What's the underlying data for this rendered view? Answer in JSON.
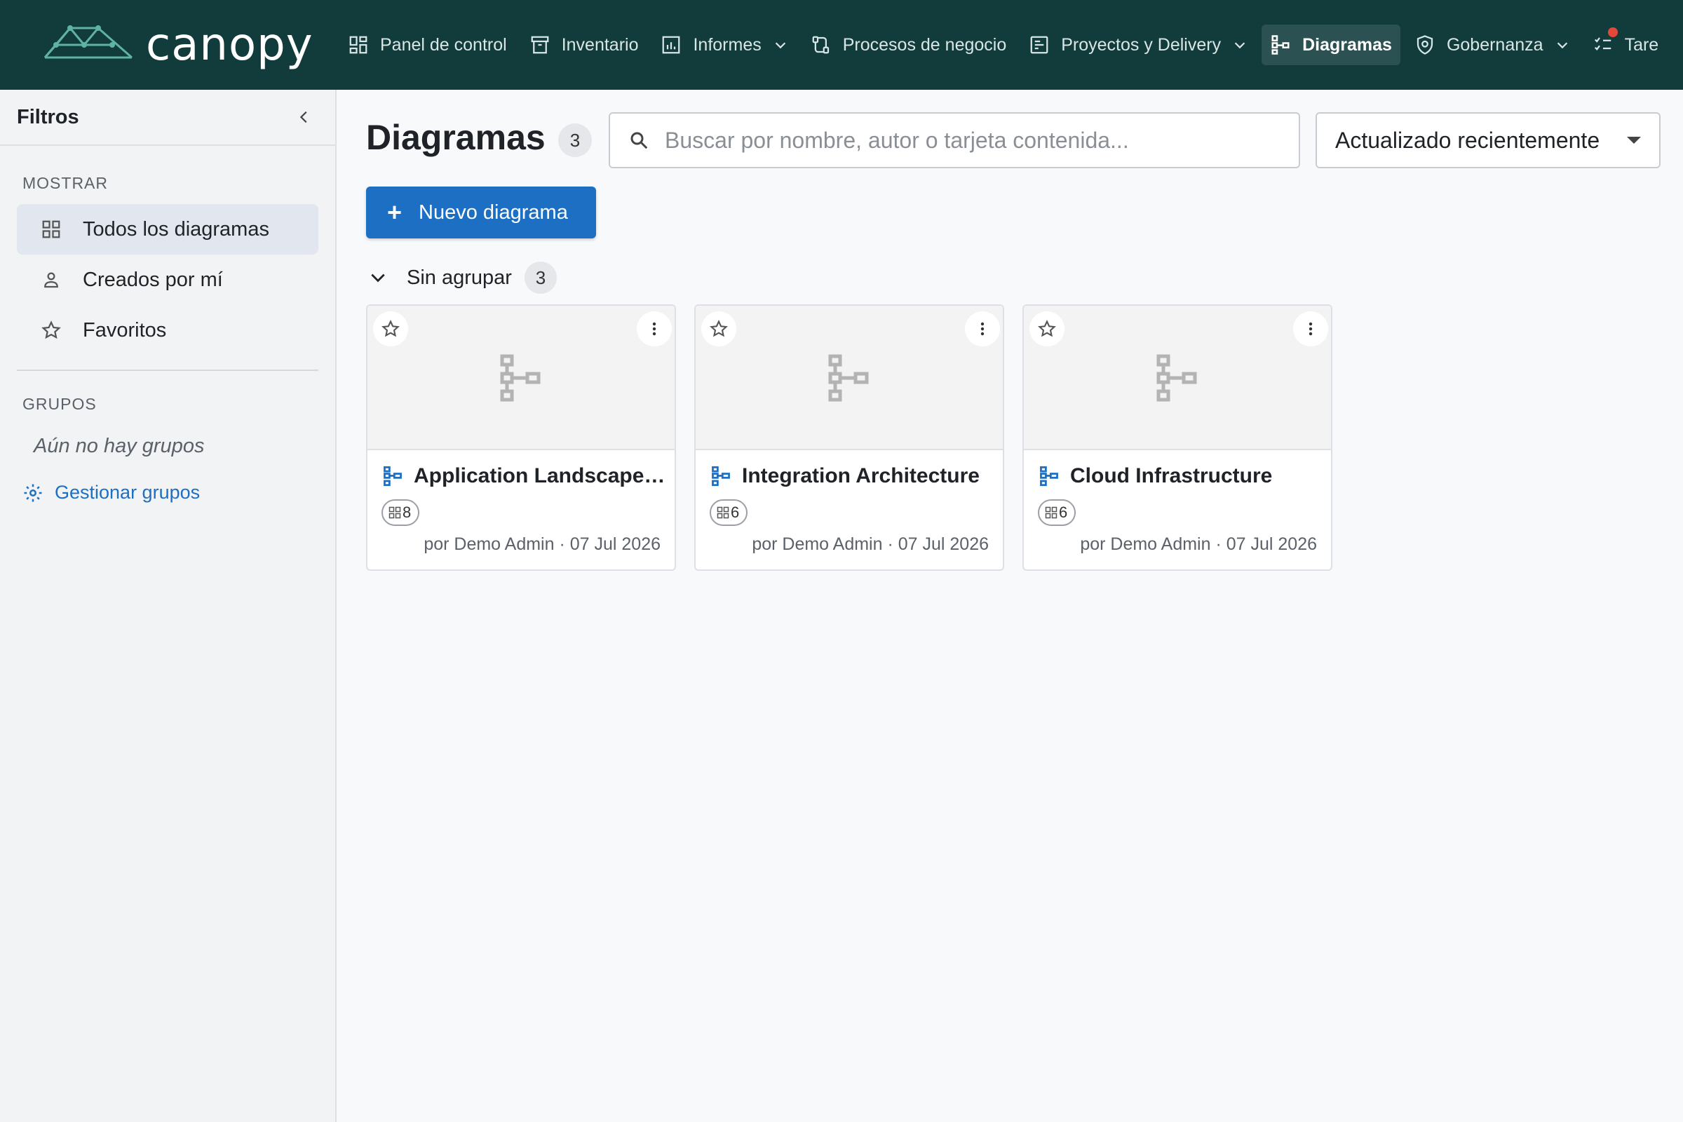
{
  "app": {
    "name": "canopy"
  },
  "nav": {
    "items": [
      {
        "label": "Panel de control",
        "icon": "dashboard-icon"
      },
      {
        "label": "Inventario",
        "icon": "archive-icon"
      },
      {
        "label": "Informes",
        "icon": "chart-icon"
      },
      {
        "label": "Procesos de negocio",
        "icon": "process-icon"
      },
      {
        "label": "Proyectos y Delivery",
        "icon": "project-icon"
      },
      {
        "label": "Diagramas",
        "icon": "diagram-icon"
      },
      {
        "label": "Gobernanza",
        "icon": "shield-icon"
      },
      {
        "label": "Tare",
        "icon": "tasks-icon"
      }
    ]
  },
  "sidebar": {
    "title": "Filtros",
    "show_label": "MOSTRAR",
    "show_items": [
      {
        "label": "Todos los diagramas",
        "icon": "grid-icon"
      },
      {
        "label": "Creados por mí",
        "icon": "person-icon"
      },
      {
        "label": "Favoritos",
        "icon": "star-icon"
      }
    ],
    "groups_label": "GRUPOS",
    "groups_empty": "Aún no hay grupos",
    "manage_label": "Gestionar grupos"
  },
  "main": {
    "title": "Diagramas",
    "count": "3",
    "search_placeholder": "Buscar por nombre, autor o tarjeta contenida...",
    "sort_label": "Actualizado recientemente",
    "new_button": "Nuevo diagrama",
    "group": {
      "label": "Sin agrupar",
      "count": "3"
    },
    "cards": [
      {
        "title": "Application Landscape ...",
        "count": "8",
        "meta": "por Demo Admin · 07 Jul 2026"
      },
      {
        "title": "Integration Architecture",
        "count": "6",
        "meta": "por Demo Admin · 07 Jul 2026"
      },
      {
        "title": "Cloud Infrastructure",
        "count": "6",
        "meta": "por Demo Admin · 07 Jul 2026"
      }
    ]
  },
  "colors": {
    "topbar": "#123b3c",
    "accent": "#1d6fc4",
    "notification": "#e5483a"
  }
}
